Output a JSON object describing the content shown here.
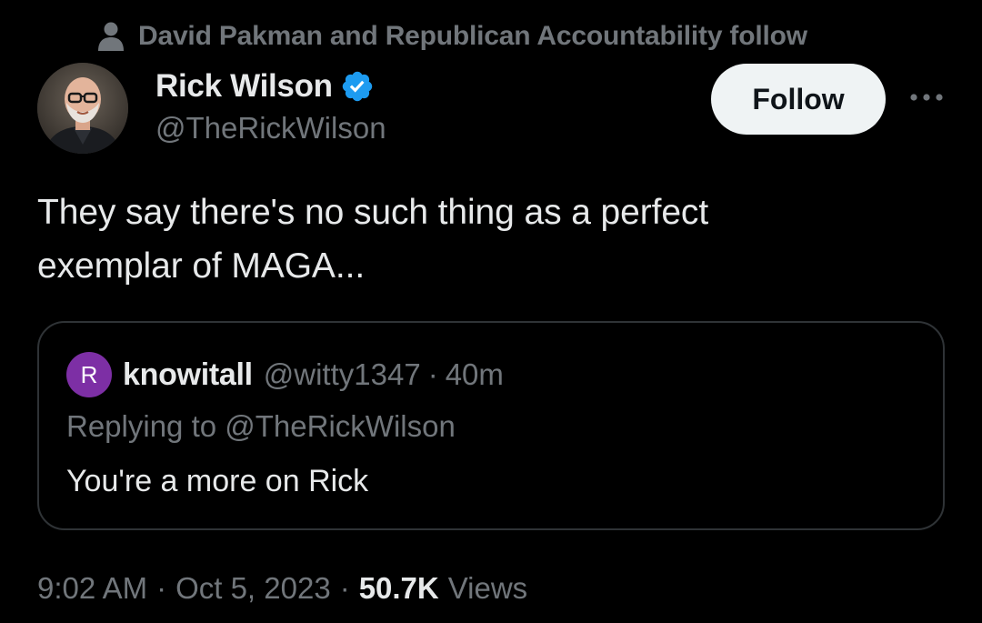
{
  "social_context": {
    "icon": "person-icon",
    "text": "David Pakman and Republican Accountability follow"
  },
  "author": {
    "avatar": "avatar",
    "name": "Rick Wilson",
    "verified_icon": "verified-badge-icon",
    "handle": "@TheRickWilson"
  },
  "actions": {
    "follow_label": "Follow",
    "more_icon": "more-icon"
  },
  "tweet": {
    "text_line_1": "They say there's no such thing as a perfect",
    "text_line_2": "exemplar of MAGA..."
  },
  "quote": {
    "avatar_letter": "R",
    "name": "knowitall",
    "handle": "@witty1347",
    "separator": "·",
    "time": "40m",
    "replying_to": "Replying to @TheRickWilson",
    "text": "You're a more on Rick"
  },
  "footer": {
    "time": "9:02 AM",
    "sep1": "·",
    "date": "Oct 5, 2023",
    "sep2": "·",
    "views_count": "50.7K",
    "views_label": "Views"
  },
  "colors": {
    "background": "#000000",
    "primary_text": "#e7e9ea",
    "secondary_text": "#71767b",
    "verified_blue": "#1d9bf0",
    "quote_avatar": "#7d2fa5",
    "follow_bg": "#eff3f4"
  }
}
